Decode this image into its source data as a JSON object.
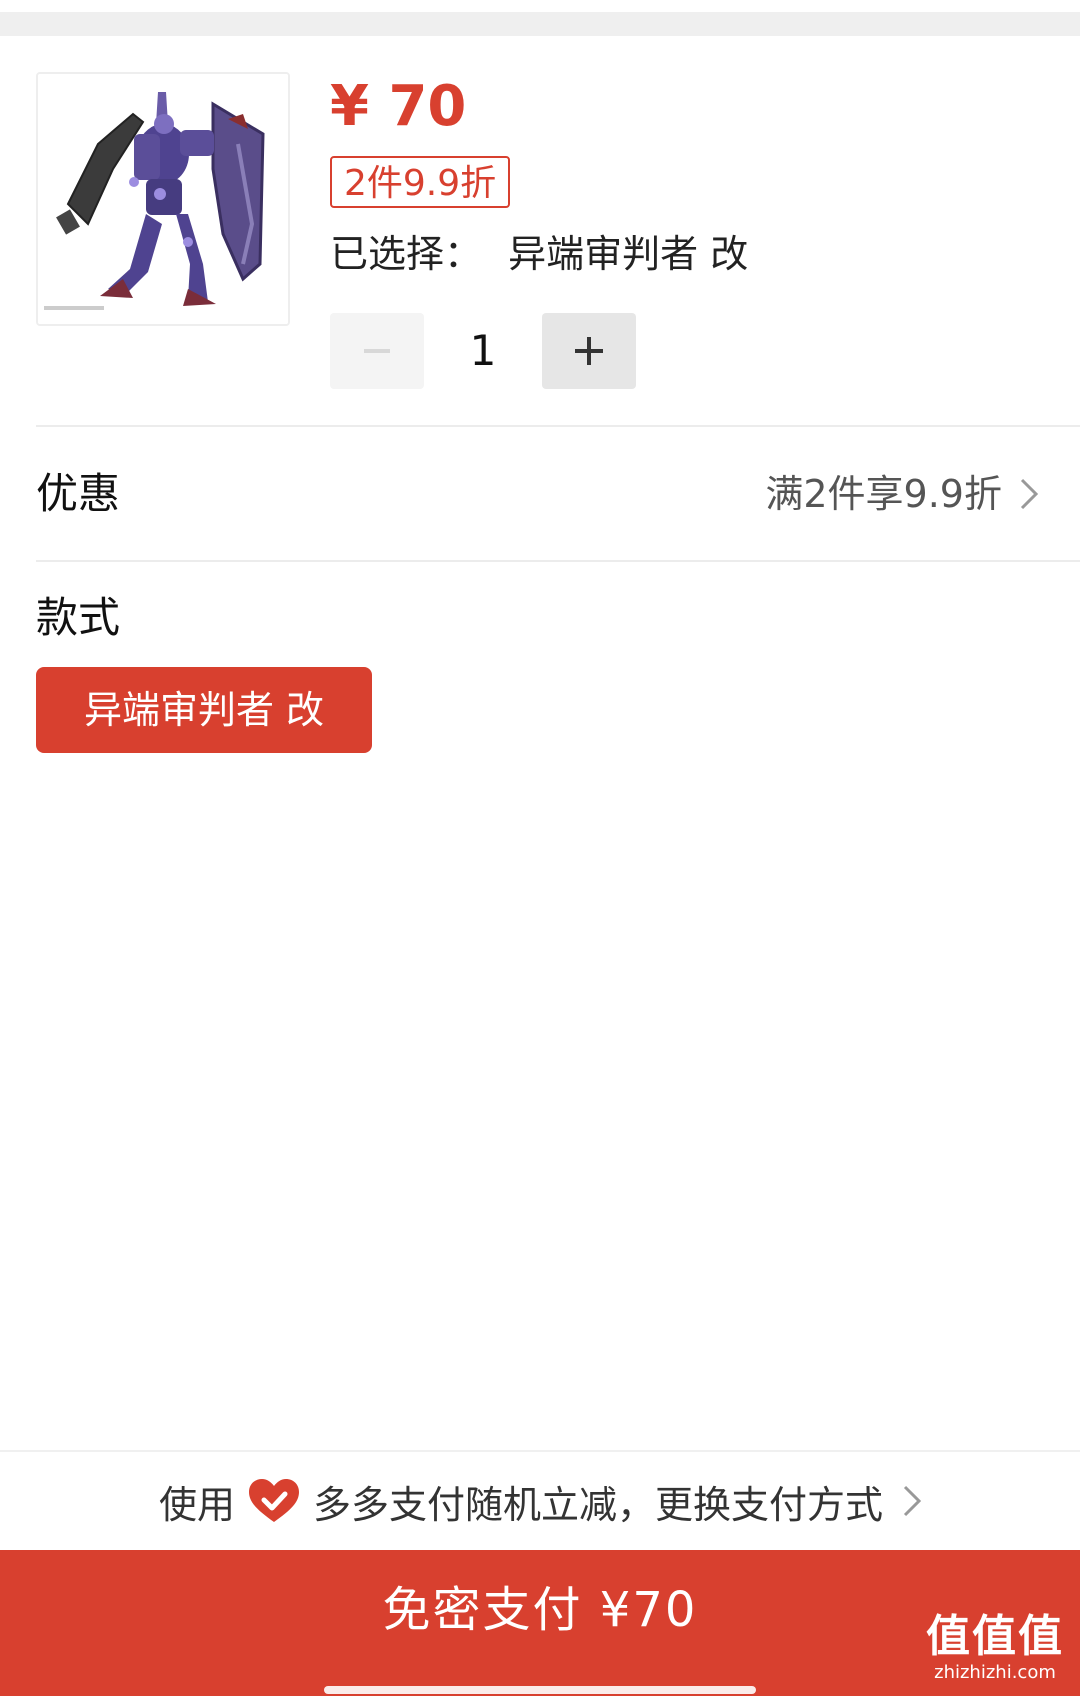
{
  "product": {
    "image_icon": "gundam-model-image",
    "price": "¥ 70",
    "discount_tag": "2件9.9折",
    "selected_prefix": "已选择：",
    "selected_value": "异端审判者 改",
    "quantity": "1",
    "minus_icon": "minus-icon",
    "plus_icon": "plus-icon"
  },
  "promotion": {
    "label": "优惠",
    "value": "满2件享9.9折",
    "chevron_icon": "chevron-right-icon"
  },
  "style": {
    "label": "款式",
    "option": "异端审判者 改"
  },
  "payment_hint": {
    "prefix": "使用",
    "icon": "heart-check-icon",
    "text": "多多支付随机立减，更换支付方式",
    "chevron_icon": "chevron-right-icon"
  },
  "pay_button": {
    "label": "免密支付 ¥70"
  },
  "watermark": {
    "big": "值值值",
    "small": "zhizhizhi.com"
  },
  "colors": {
    "accent": "#d8402f",
    "text": "#111111",
    "muted": "#555555",
    "divider": "#ececec"
  }
}
